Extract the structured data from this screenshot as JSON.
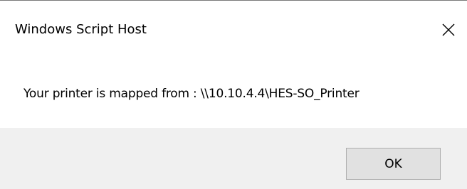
{
  "window": {
    "title": "Windows Script Host",
    "close_icon": "close-icon"
  },
  "content": {
    "message": "Your printer is mapped from : \\\\10.10.4.4\\HES-SO_Printer"
  },
  "footer": {
    "ok_label": "OK"
  },
  "colors": {
    "background": "#ffffff",
    "footer_background": "#f0f0f0",
    "button_background": "#e1e1e1",
    "button_border": "#adadad",
    "top_border": "#7a7a7a",
    "text": "#000000"
  }
}
